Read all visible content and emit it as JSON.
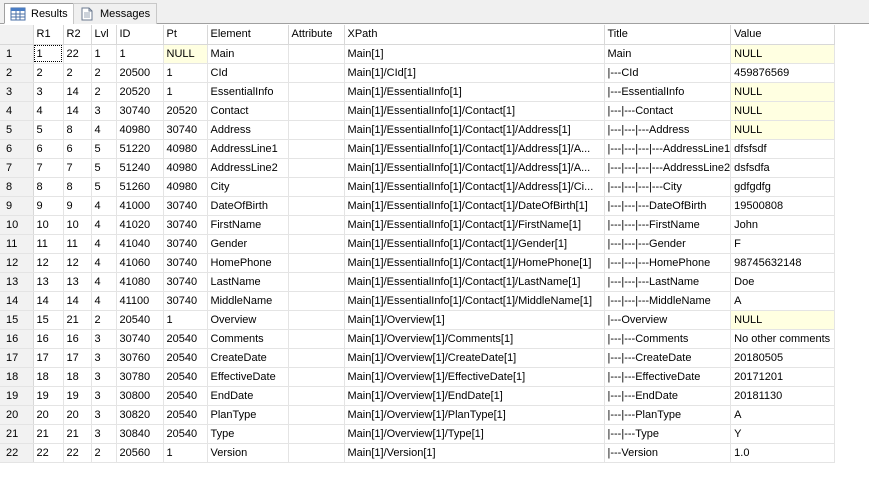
{
  "tabs": [
    {
      "label": "Results",
      "icon": "grid-icon",
      "active": true
    },
    {
      "label": "Messages",
      "icon": "document-icon",
      "active": false
    }
  ],
  "columns": [
    "R1",
    "R2",
    "Lvl",
    "ID",
    "Pt",
    "Element",
    "Attribute",
    "XPath",
    "Title",
    "Value"
  ],
  "null_color": "#ffffe1",
  "rows": [
    [
      "1",
      "1",
      "22",
      "1",
      "1",
      "NULL",
      "Main",
      "",
      "Main[1]",
      "Main",
      "NULL"
    ],
    [
      "2",
      "2",
      "2",
      "2",
      "20500",
      "1",
      "CId",
      "",
      "Main[1]/CId[1]",
      "|---CId",
      "459876569"
    ],
    [
      "3",
      "3",
      "14",
      "2",
      "20520",
      "1",
      "EssentialInfo",
      "",
      "Main[1]/EssentialInfo[1]",
      "|---EssentialInfo",
      "NULL"
    ],
    [
      "4",
      "4",
      "14",
      "3",
      "30740",
      "20520",
      "Contact",
      "",
      "Main[1]/EssentialInfo[1]/Contact[1]",
      "|---|---Contact",
      "NULL"
    ],
    [
      "5",
      "5",
      "8",
      "4",
      "40980",
      "30740",
      "Address",
      "",
      "Main[1]/EssentialInfo[1]/Contact[1]/Address[1]",
      "|---|---|---Address",
      "NULL"
    ],
    [
      "6",
      "6",
      "6",
      "5",
      "51220",
      "40980",
      "AddressLine1",
      "",
      "Main[1]/EssentialInfo[1]/Contact[1]/Address[1]/A...",
      "|---|---|---|---AddressLine1",
      "dfsfsdf"
    ],
    [
      "7",
      "7",
      "7",
      "5",
      "51240",
      "40980",
      "AddressLine2",
      "",
      "Main[1]/EssentialInfo[1]/Contact[1]/Address[1]/A...",
      "|---|---|---|---AddressLine2",
      "dsfsdfa"
    ],
    [
      "8",
      "8",
      "8",
      "5",
      "51260",
      "40980",
      "City",
      "",
      "Main[1]/EssentialInfo[1]/Contact[1]/Address[1]/Ci...",
      "|---|---|---|---City",
      "gdfgdfg"
    ],
    [
      "9",
      "9",
      "9",
      "4",
      "41000",
      "30740",
      "DateOfBirth",
      "",
      "Main[1]/EssentialInfo[1]/Contact[1]/DateOfBirth[1]",
      "|---|---|---DateOfBirth",
      "19500808"
    ],
    [
      "10",
      "10",
      "10",
      "4",
      "41020",
      "30740",
      "FirstName",
      "",
      "Main[1]/EssentialInfo[1]/Contact[1]/FirstName[1]",
      "|---|---|---FirstName",
      "John"
    ],
    [
      "11",
      "11",
      "11",
      "4",
      "41040",
      "30740",
      "Gender",
      "",
      "Main[1]/EssentialInfo[1]/Contact[1]/Gender[1]",
      "|---|---|---Gender",
      "F"
    ],
    [
      "12",
      "12",
      "12",
      "4",
      "41060",
      "30740",
      "HomePhone",
      "",
      "Main[1]/EssentialInfo[1]/Contact[1]/HomePhone[1]",
      "|---|---|---HomePhone",
      "98745632148"
    ],
    [
      "13",
      "13",
      "13",
      "4",
      "41080",
      "30740",
      "LastName",
      "",
      "Main[1]/EssentialInfo[1]/Contact[1]/LastName[1]",
      "|---|---|---LastName",
      "Doe"
    ],
    [
      "14",
      "14",
      "14",
      "4",
      "41100",
      "30740",
      "MiddleName",
      "",
      "Main[1]/EssentialInfo[1]/Contact[1]/MiddleName[1]",
      "|---|---|---MiddleName",
      "A"
    ],
    [
      "15",
      "15",
      "21",
      "2",
      "20540",
      "1",
      "Overview",
      "",
      "Main[1]/Overview[1]",
      "|---Overview",
      "NULL"
    ],
    [
      "16",
      "16",
      "16",
      "3",
      "30740",
      "20540",
      "Comments",
      "",
      "Main[1]/Overview[1]/Comments[1]",
      "|---|---Comments",
      "No other comments"
    ],
    [
      "17",
      "17",
      "17",
      "3",
      "30760",
      "20540",
      "CreateDate",
      "",
      "Main[1]/Overview[1]/CreateDate[1]",
      "|---|---CreateDate",
      "20180505"
    ],
    [
      "18",
      "18",
      "18",
      "3",
      "30780",
      "20540",
      "EffectiveDate",
      "",
      "Main[1]/Overview[1]/EffectiveDate[1]",
      "|---|---EffectiveDate",
      "20171201"
    ],
    [
      "19",
      "19",
      "19",
      "3",
      "30800",
      "20540",
      "EndDate",
      "",
      "Main[1]/Overview[1]/EndDate[1]",
      "|---|---EndDate",
      "20181130"
    ],
    [
      "20",
      "20",
      "20",
      "3",
      "30820",
      "20540",
      "PlanType",
      "",
      "Main[1]/Overview[1]/PlanType[1]",
      "|---|---PlanType",
      "A"
    ],
    [
      "21",
      "21",
      "21",
      "3",
      "30840",
      "20540",
      "Type",
      "",
      "Main[1]/Overview[1]/Type[1]",
      "|---|---Type",
      "Y"
    ],
    [
      "22",
      "22",
      "22",
      "2",
      "20560",
      "1",
      "Version",
      "",
      "Main[1]/Version[1]",
      "|---Version",
      "1.0"
    ]
  ]
}
